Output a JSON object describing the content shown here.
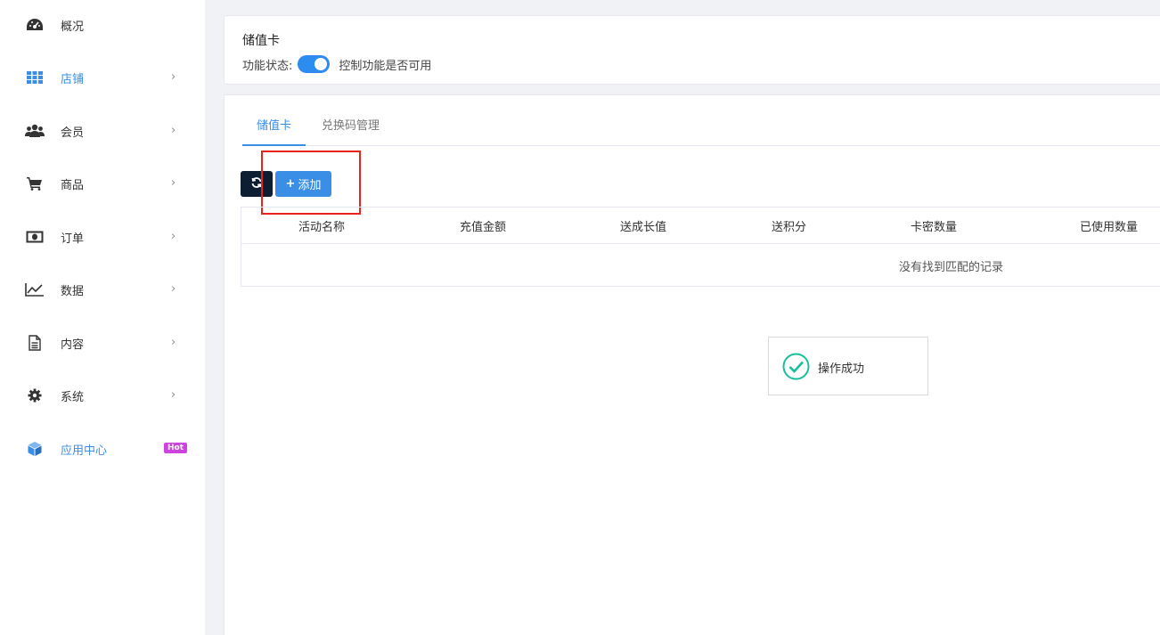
{
  "sidebar": {
    "items": [
      {
        "label": "概况",
        "icon": "dashboard-icon",
        "has_chevron": false
      },
      {
        "label": "店铺",
        "icon": "grid-icon",
        "has_chevron": true
      },
      {
        "label": "会员",
        "icon": "users-icon",
        "has_chevron": true
      },
      {
        "label": "商品",
        "icon": "cart-icon",
        "has_chevron": true
      },
      {
        "label": "订单",
        "icon": "money-icon",
        "has_chevron": true
      },
      {
        "label": "数据",
        "icon": "line-chart-icon",
        "has_chevron": true
      },
      {
        "label": "内容",
        "icon": "document-icon",
        "has_chevron": true
      },
      {
        "label": "系统",
        "icon": "gear-icon",
        "has_chevron": true
      },
      {
        "label": "应用中心",
        "icon": "cube-icon",
        "badge": "Hot"
      }
    ],
    "active_item": "店铺",
    "chevron": "›"
  },
  "header_card": {
    "title": "储值卡",
    "status_label": "功能状态:",
    "toggle_on": true,
    "toggle_desc": "控制功能是否可用"
  },
  "tabs": [
    {
      "label": "储值卡",
      "active": true
    },
    {
      "label": "兑换码管理",
      "active": false
    }
  ],
  "toolbar": {
    "refresh_icon": "refresh-icon",
    "add_label": "添加",
    "add_icon": "+"
  },
  "table": {
    "columns": [
      "活动名称",
      "充值金额",
      "送成长值",
      "送积分",
      "卡密数量",
      "已使用数量"
    ],
    "rows": [],
    "empty_text": "没有找到匹配的记录"
  },
  "toast": {
    "text": "操作成功",
    "icon": "check-circle-icon"
  },
  "colors": {
    "accent": "#3a8ee6",
    "refresh_button": "#0d1e33",
    "hot_badge": "#cc44dd",
    "highlight": "#e8231f",
    "toast_check": "#19be9b"
  }
}
